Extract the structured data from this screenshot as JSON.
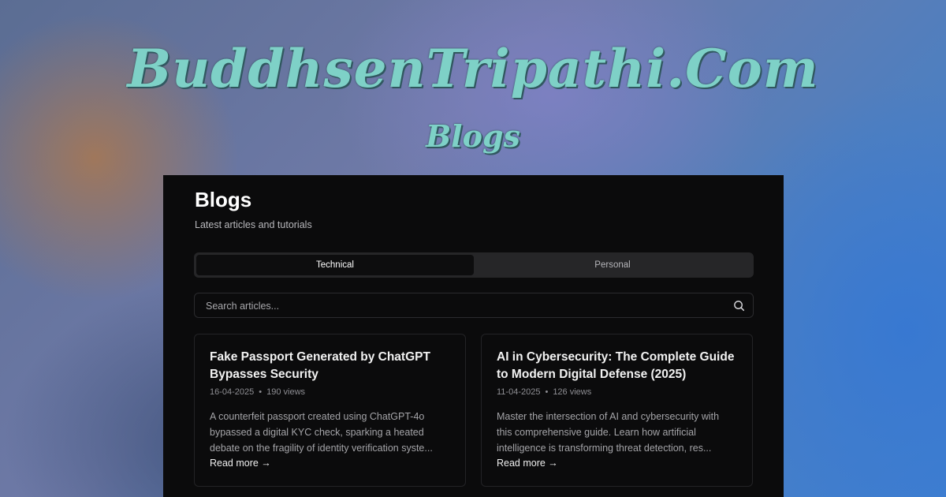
{
  "brand": {
    "title": "BuddhsenTripathi.Com",
    "subtitle": "Blogs"
  },
  "page": {
    "title": "Blogs",
    "subtitle": "Latest articles and tutorials"
  },
  "tabs": [
    {
      "label": "Technical",
      "active": true
    },
    {
      "label": "Personal",
      "active": false
    }
  ],
  "search": {
    "placeholder": "Search articles...",
    "value": ""
  },
  "posts": [
    {
      "title": "Fake Passport Generated by ChatGPT Bypasses Security",
      "date": "16-04-2025",
      "views": "190 views",
      "excerpt": "A counterfeit passport created using ChatGPT-4o bypassed a digital KYC check, sparking a heated debate on the fragility of identity verification syste...",
      "link": "Read more →"
    },
    {
      "title": "AI in Cybersecurity: The Complete Guide to Modern Digital Defense (2025)",
      "date": "11-04-2025",
      "views": "126 views",
      "excerpt": "Master the intersection of AI and cybersecurity with this comprehensive guide. Learn how artificial intelligence is transforming threat detection, res...",
      "link": "Read more →"
    }
  ],
  "colors": {
    "brand_text": "#7ed1c7",
    "panel_bg": "#0b0b0c"
  },
  "icons": {
    "search": "search-icon"
  }
}
